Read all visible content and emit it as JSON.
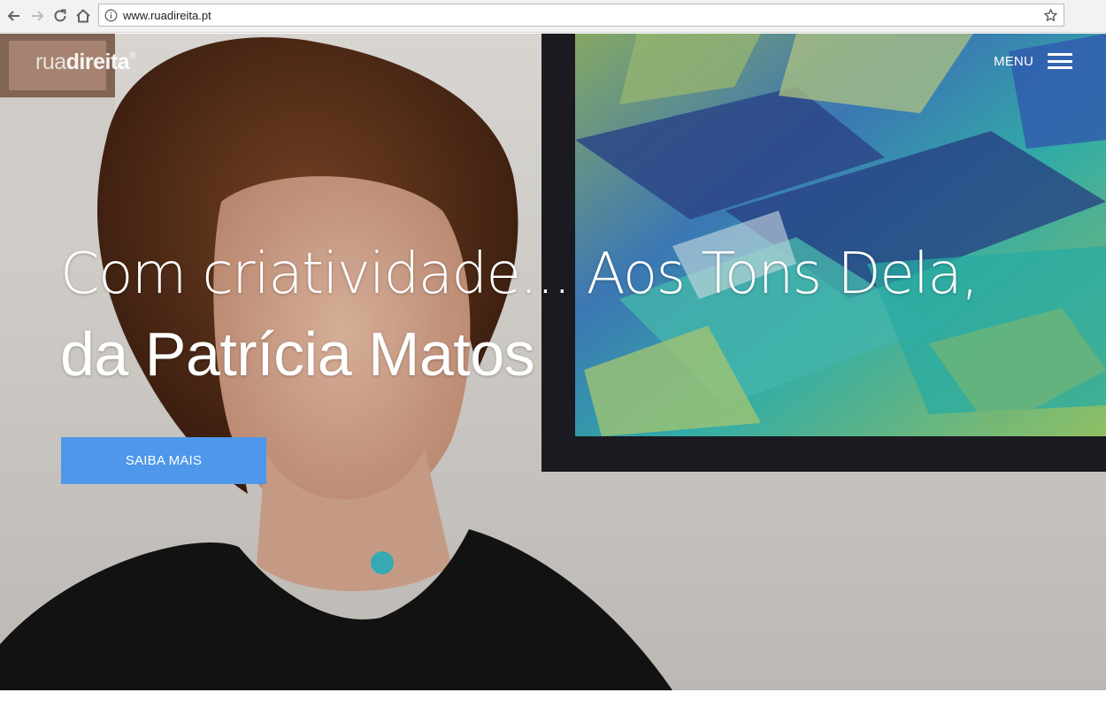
{
  "browser": {
    "url": "www.ruadireita.pt"
  },
  "site": {
    "logo_light": "rua",
    "logo_bold": "direita",
    "logo_mark": "®",
    "menu_label": "MENU"
  },
  "hero": {
    "headline_line1": "Com criatividade... Aos Tons Dela,",
    "headline_line2": "da Patrícia Matos",
    "cta_label": "SAIBA MAIS"
  },
  "colors": {
    "cta": "#4e97ea",
    "text_on_hero": "#ffffff",
    "browser_chrome": "#f2f2f2"
  },
  "icons": [
    "back-arrow-icon",
    "forward-arrow-icon",
    "reload-icon",
    "home-icon",
    "info-icon",
    "star-icon",
    "hamburger-icon"
  ]
}
